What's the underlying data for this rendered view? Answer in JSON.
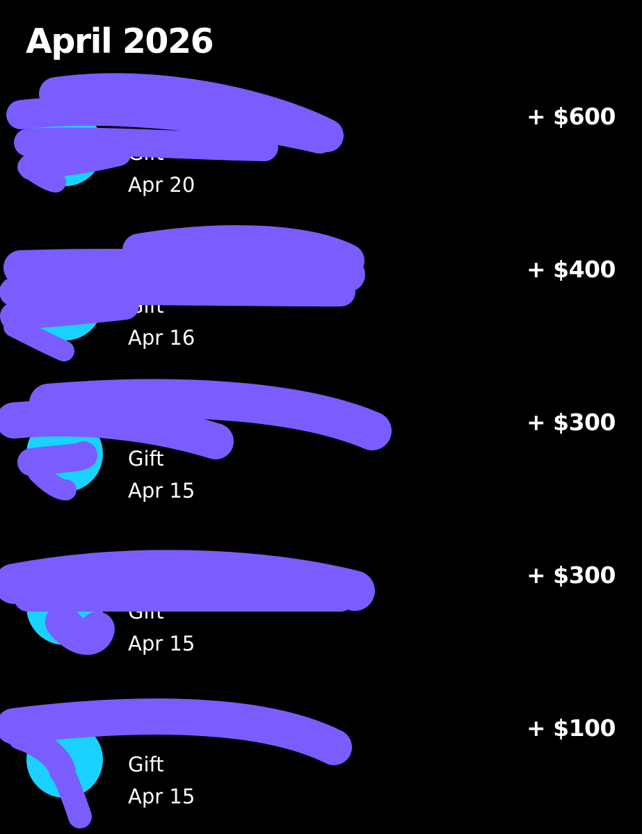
{
  "header": {
    "month_title": "April 2026"
  },
  "colors": {
    "background": "#000000",
    "text": "#ffffff",
    "avatar": "#19d2ff",
    "redaction": "#7b5cff"
  },
  "transactions": [
    {
      "name": "",
      "type": "Gift",
      "date": "Apr 20",
      "amount": "+ $600"
    },
    {
      "name": "",
      "type": "Gift",
      "date": "Apr 16",
      "amount": "+ $400"
    },
    {
      "name": "",
      "type": "Gift",
      "date": "Apr 15",
      "amount": "+ $300"
    },
    {
      "name": "",
      "type": "Gift",
      "date": "Apr 15",
      "amount": "+ $300"
    },
    {
      "name": "",
      "type": "Gift",
      "date": "Apr 15",
      "amount": "+ $100"
    }
  ]
}
